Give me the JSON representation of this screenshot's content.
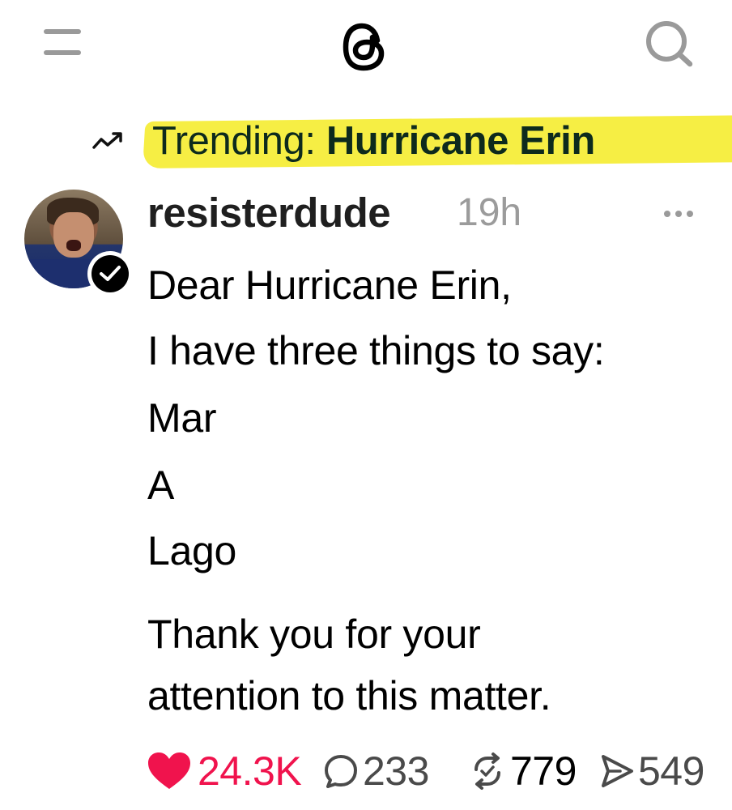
{
  "header": {
    "menu_icon": "hamburger-icon",
    "logo_icon": "threads-logo",
    "search_icon": "search-icon"
  },
  "trending": {
    "icon": "trending-arrow-icon",
    "label": "Trending: ",
    "topic": "Hurricane Erin",
    "highlight_color": "#f6ee44"
  },
  "post": {
    "author": {
      "username": "resisterdude",
      "verified": true
    },
    "timestamp": "19h",
    "lines": [
      "Dear Hurricane Erin,",
      "I have three things to say:",
      "Mar",
      "A",
      "Lago",
      "Thank you for your",
      "attention to this matter."
    ],
    "actions": {
      "likes": "24.3K",
      "comments": "233",
      "reposts": "779",
      "shares": "549",
      "liked": true,
      "like_color": "#f0134d"
    }
  }
}
